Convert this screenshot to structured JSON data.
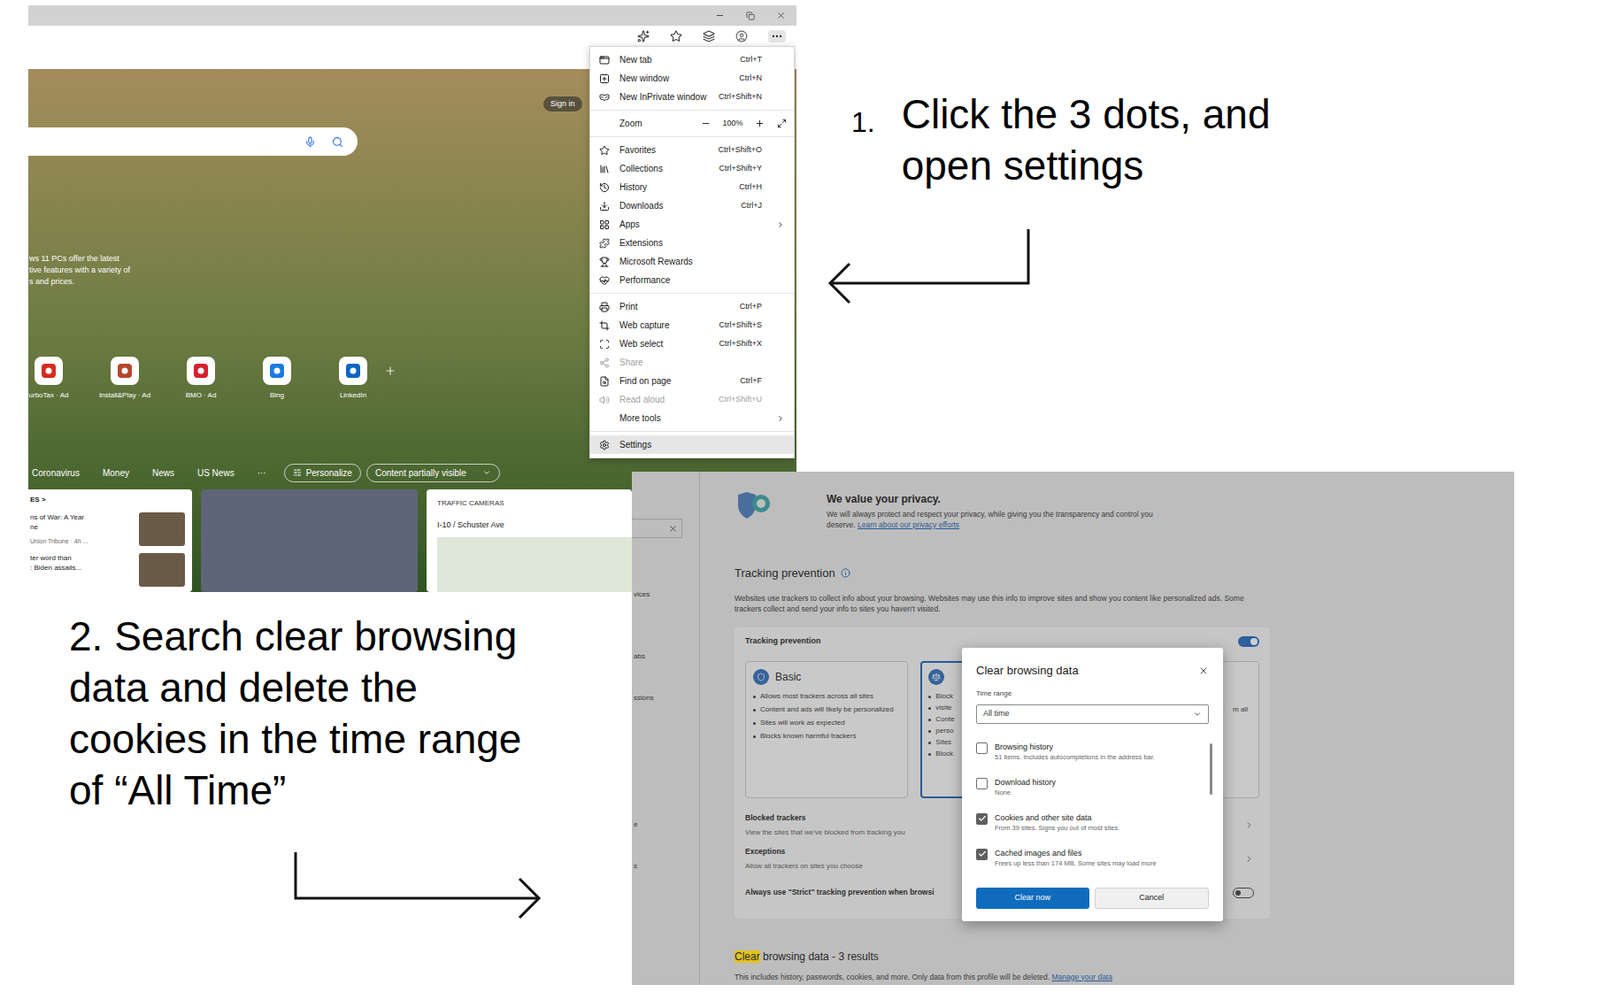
{
  "instruction_1": {
    "number": "1.",
    "lines": [
      "Click the 3 dots, and",
      "open settings"
    ]
  },
  "instruction_2": {
    "lines": [
      "2. Search clear browsing",
      "data and delete the",
      "cookies in the time range",
      "of “All Time”"
    ]
  },
  "browser": {
    "sign_in": "Sign in",
    "news_snippet": [
      "ws 11 PCs offer the latest",
      "tive features with a variety of",
      "s and prices."
    ],
    "quick_links": [
      {
        "label": "urboTax · Ad",
        "color": "#d52b1e"
      },
      {
        "label": "Install&Play · Ad",
        "color": "#b5452c"
      },
      {
        "label": "BMO · Ad",
        "color": "#d6202f"
      },
      {
        "label": "Bing",
        "color": "#1b7ae0"
      },
      {
        "label": "LinkedIn",
        "color": "#0a66c2"
      }
    ],
    "feed_tabs": [
      "Coronavirus",
      "Money",
      "News",
      "US News",
      "···"
    ],
    "personalize": "Personalize",
    "content_filter": "Content partially visible",
    "news_card": {
      "header": "ES >",
      "stories": [
        {
          "lines": [
            "ns of War: A Year",
            "ne"
          ],
          "source": "Union Tribune · 4h ..."
        },
        {
          "lines": [
            "ter word than",
            ": Biden assails..."
          ]
        }
      ]
    },
    "traffic_card": {
      "title": "TRAFFIC CAMERAS",
      "location": "I-10 / Schuster Ave"
    }
  },
  "menu": {
    "sections": [
      [
        {
          "kind": "item",
          "label": "New tab",
          "shortcut": "Ctrl+T",
          "submenu": false,
          "disabled": false,
          "selected": false
        },
        {
          "kind": "item",
          "label": "New window",
          "shortcut": "Ctrl+N",
          "submenu": false,
          "disabled": false,
          "selected": false
        },
        {
          "kind": "item",
          "label": "New InPrivate window",
          "shortcut": "Ctrl+Shift+N",
          "submenu": false,
          "disabled": false,
          "selected": false
        }
      ],
      [
        {
          "kind": "zoom",
          "label": "Zoom",
          "value": "100%"
        }
      ],
      [
        {
          "kind": "item",
          "label": "Favorites",
          "shortcut": "Ctrl+Shift+O",
          "submenu": false,
          "disabled": false,
          "selected": false
        },
        {
          "kind": "item",
          "label": "Collections",
          "shortcut": "Ctrl+Shift+Y",
          "submenu": false,
          "disabled": false,
          "selected": false
        },
        {
          "kind": "item",
          "label": "History",
          "shortcut": "Ctrl+H",
          "submenu": false,
          "disabled": false,
          "selected": false
        },
        {
          "kind": "item",
          "label": "Downloads",
          "shortcut": "Ctrl+J",
          "submenu": false,
          "disabled": false,
          "selected": false
        },
        {
          "kind": "item",
          "label": "Apps",
          "shortcut": "",
          "submenu": true,
          "disabled": false,
          "selected": false
        },
        {
          "kind": "item",
          "label": "Extensions",
          "shortcut": "",
          "submenu": false,
          "disabled": false,
          "selected": false
        },
        {
          "kind": "item",
          "label": "Microsoft Rewards",
          "shortcut": "",
          "submenu": false,
          "disabled": false,
          "selected": false
        },
        {
          "kind": "item",
          "label": "Performance",
          "shortcut": "",
          "submenu": false,
          "disabled": false,
          "selected": false
        }
      ],
      [
        {
          "kind": "item",
          "label": "Print",
          "shortcut": "Ctrl+P",
          "submenu": false,
          "disabled": false,
          "selected": false
        },
        {
          "kind": "item",
          "label": "Web capture",
          "shortcut": "Ctrl+Shift+S",
          "submenu": false,
          "disabled": false,
          "selected": false
        },
        {
          "kind": "item",
          "label": "Web select",
          "shortcut": "Ctrl+Shift+X",
          "submenu": false,
          "disabled": false,
          "selected": false
        },
        {
          "kind": "item",
          "label": "Share",
          "shortcut": "",
          "submenu": false,
          "disabled": true,
          "selected": false
        },
        {
          "kind": "item",
          "label": "Find on page",
          "shortcut": "Ctrl+F",
          "submenu": false,
          "disabled": false,
          "selected": false
        },
        {
          "kind": "item",
          "label": "Read aloud",
          "shortcut": "Ctrl+Shift+U",
          "submenu": false,
          "disabled": true,
          "selected": false
        },
        {
          "kind": "item",
          "label": "More tools",
          "shortcut": "",
          "submenu": true,
          "disabled": false,
          "selected": false
        }
      ],
      [
        {
          "kind": "item",
          "label": "Settings",
          "shortcut": "",
          "submenu": false,
          "disabled": false,
          "selected": true
        }
      ]
    ]
  },
  "settings": {
    "sidebar": {
      "items": [
        "vices",
        "abs",
        "ssions",
        "e",
        "s"
      ]
    },
    "privacy": {
      "title": "We value your privacy.",
      "text": "We will always protect and respect your privacy, while giving you the transparency and control you deserve.",
      "link": "Learn about our privacy efforts"
    },
    "tracking": {
      "title": "Tracking prevention",
      "description": "Websites use trackers to collect info about your browsing. Websites may use this info to improve sites and show you content like personalized ads. Some trackers collect and send your info to sites you haven't visited.",
      "box_title": "Tracking prevention",
      "on": true,
      "levels": [
        {
          "kind": "full",
          "name": "Basic",
          "selected": false,
          "bullets": [
            "Allows most trackers across all sites",
            "Content and ads will likely be personalized",
            "Sites will work as expected",
            "Blocks known harmful trackers"
          ]
        },
        {
          "kind": "left",
          "selected": true,
          "bullets": [
            "Block",
            "visite",
            "Conte",
            "perso",
            "Sites",
            "Block"
          ]
        },
        {
          "kind": "right",
          "selected": false,
          "bullets": [
            "m all"
          ]
        }
      ],
      "rows": [
        {
          "kind": "link",
          "title": "Blocked trackers",
          "subtitle": "View the sites that we've blocked from tracking you"
        },
        {
          "kind": "link",
          "title": "Exceptions",
          "subtitle": "Allow all trackers on sites you choose"
        },
        {
          "kind": "toggle",
          "title": "Always use \"Strict\" tracking prevention when browsi",
          "on": false
        }
      ]
    },
    "results": {
      "highlight": "Clear",
      "title": " browsing data - 3 results",
      "text": "This includes history, passwords, cookies, and more. Only data from this profile will be deleted.",
      "link": "Manage your data"
    },
    "dialog": {
      "title": "Clear browsing data",
      "time_range_label": "Time range",
      "time_range": "All time",
      "options": [
        {
          "label": "Browsing history",
          "detail": "51 items. Includes autocompletions in the address bar.",
          "checked": false
        },
        {
          "label": "Download history",
          "detail": "None",
          "checked": false
        },
        {
          "label": "Cookies and other site data",
          "detail": "From 39 sites. Signs you out of most sites.",
          "checked": true
        },
        {
          "label": "Cached images and files",
          "detail": "Frees up less than 174 MB. Some sites may load more",
          "checked": true
        }
      ],
      "buttons": [
        {
          "label": "Clear now",
          "primary": true
        },
        {
          "label": "Cancel",
          "primary": false
        }
      ]
    }
  }
}
